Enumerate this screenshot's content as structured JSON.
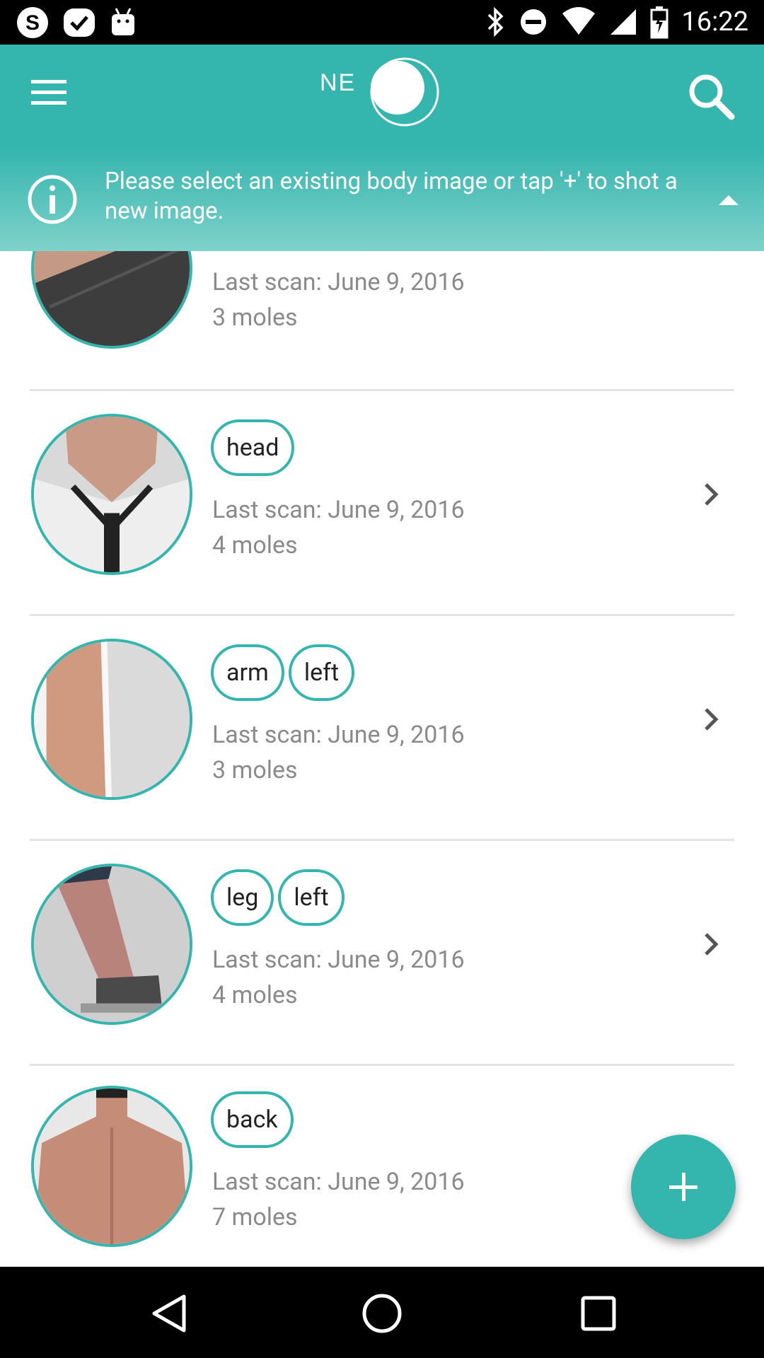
{
  "status_bar": {
    "time": "16:22",
    "left_icons": [
      "skype-icon",
      "check-badge-icon",
      "android-icon"
    ],
    "right_icons": [
      "bluetooth-icon",
      "do-not-disturb-icon",
      "wifi-icon",
      "signal-icon",
      "battery-charging-icon"
    ]
  },
  "app_bar": {
    "logo_text": "NE",
    "menu_icon": "hamburger-menu-icon",
    "search_icon": "search-icon",
    "color": "#34b5ad"
  },
  "banner": {
    "text": "Please select an existing body image or tap '+' to shot a new image.",
    "icon": "info-icon",
    "collapse_icon": "caret-up-icon"
  },
  "items": [
    {
      "tags": [],
      "last_scan": "Last scan: June 9, 2016",
      "moles": "3 moles"
    },
    {
      "tags": [
        "head"
      ],
      "last_scan": "Last scan: June 9, 2016",
      "moles": "4 moles"
    },
    {
      "tags": [
        "arm",
        "left"
      ],
      "last_scan": "Last scan: June 9, 2016",
      "moles": "3 moles"
    },
    {
      "tags": [
        "leg",
        "left"
      ],
      "last_scan": "Last scan: June 9, 2016",
      "moles": "4 moles"
    },
    {
      "tags": [
        "back"
      ],
      "last_scan": "Last scan: June 9, 2016",
      "moles": "7 moles"
    }
  ],
  "fab": {
    "icon": "plus-icon"
  },
  "nav_bar": {
    "icons": [
      "back-icon",
      "home-icon",
      "recents-icon"
    ]
  },
  "colors": {
    "accent": "#34b5ad",
    "secondary_text": "#8a8a8a"
  }
}
